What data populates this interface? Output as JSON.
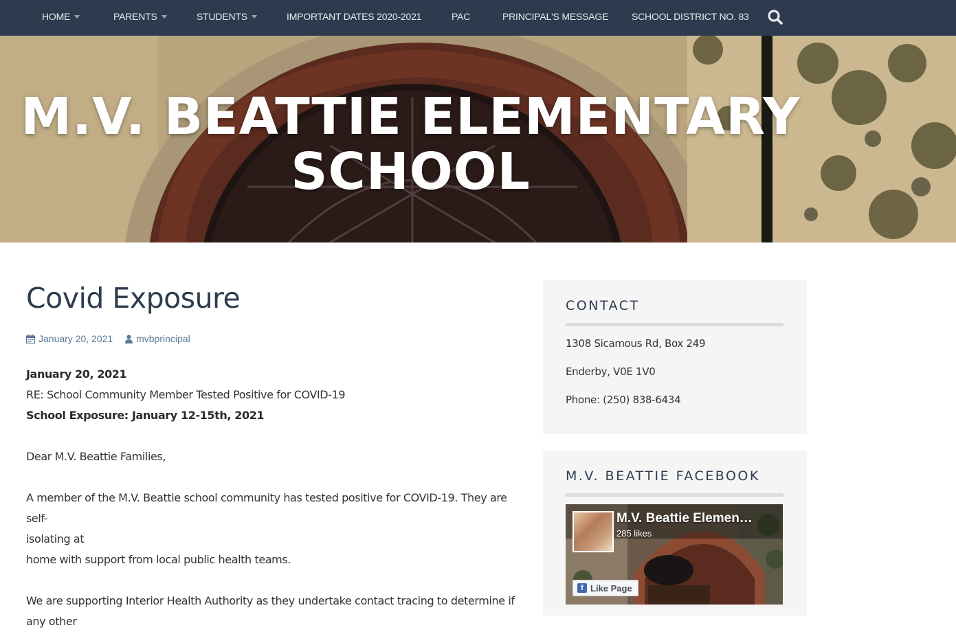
{
  "nav": {
    "items": [
      {
        "label": "HOME",
        "has_dropdown": true
      },
      {
        "label": "PARENTS",
        "has_dropdown": true
      },
      {
        "label": "STUDENTS",
        "has_dropdown": true
      },
      {
        "label": "IMPORTANT DATES 2020-2021",
        "has_dropdown": false
      },
      {
        "label": "PAC",
        "has_dropdown": false
      },
      {
        "label": "PRINCIPAL'S MESSAGE",
        "has_dropdown": false
      },
      {
        "label": "SCHOOL DISTRICT NO. 83",
        "has_dropdown": false
      }
    ],
    "search_icon": "search-icon"
  },
  "hero": {
    "title_line1": "M.V. BEATTIE ELEMENTARY",
    "title_line2": "SCHOOL"
  },
  "post": {
    "title": "Covid Exposure",
    "date": "January 20, 2021",
    "author": "mvbprincipal",
    "date_icon": "calendar-icon",
    "author_icon": "user-icon",
    "body": {
      "date_line": "January 20, 2021",
      "re_line": "RE: School Community Member Tested Positive for COVID-19",
      "exposure_line": "School Exposure: January 12-15th, 2021",
      "greeting": "Dear M.V. Beattie Families,",
      "para1_line1": "A member of the M.V. Beattie school community has tested positive for COVID-19. They are self-",
      "para1_line2": "isolating at",
      "para1_line3": "home with support from local public health teams.",
      "para2_line1": "We are supporting Interior Health Authority as they undertake contact tracing to determine if",
      "para2_line2": "any other"
    }
  },
  "sidebar": {
    "contact": {
      "title": "CONTACT",
      "address": "1308 Sicamous Rd, Box 249",
      "city": "Enderby, V0E 1V0",
      "phone": "Phone: (250) 838-6434"
    },
    "facebook": {
      "title": "M.V. BEATTIE FACEBOOK",
      "page_name": "M.V. Beattie Elemen…",
      "likes": "285 likes",
      "like_button": "Like Page"
    }
  },
  "colors": {
    "nav_bg": "#2e3b4e",
    "title_color": "#2e3b4e",
    "meta_color": "#5a7896",
    "widget_bg": "#f5f5f5",
    "facebook_blue": "#4267b2"
  }
}
